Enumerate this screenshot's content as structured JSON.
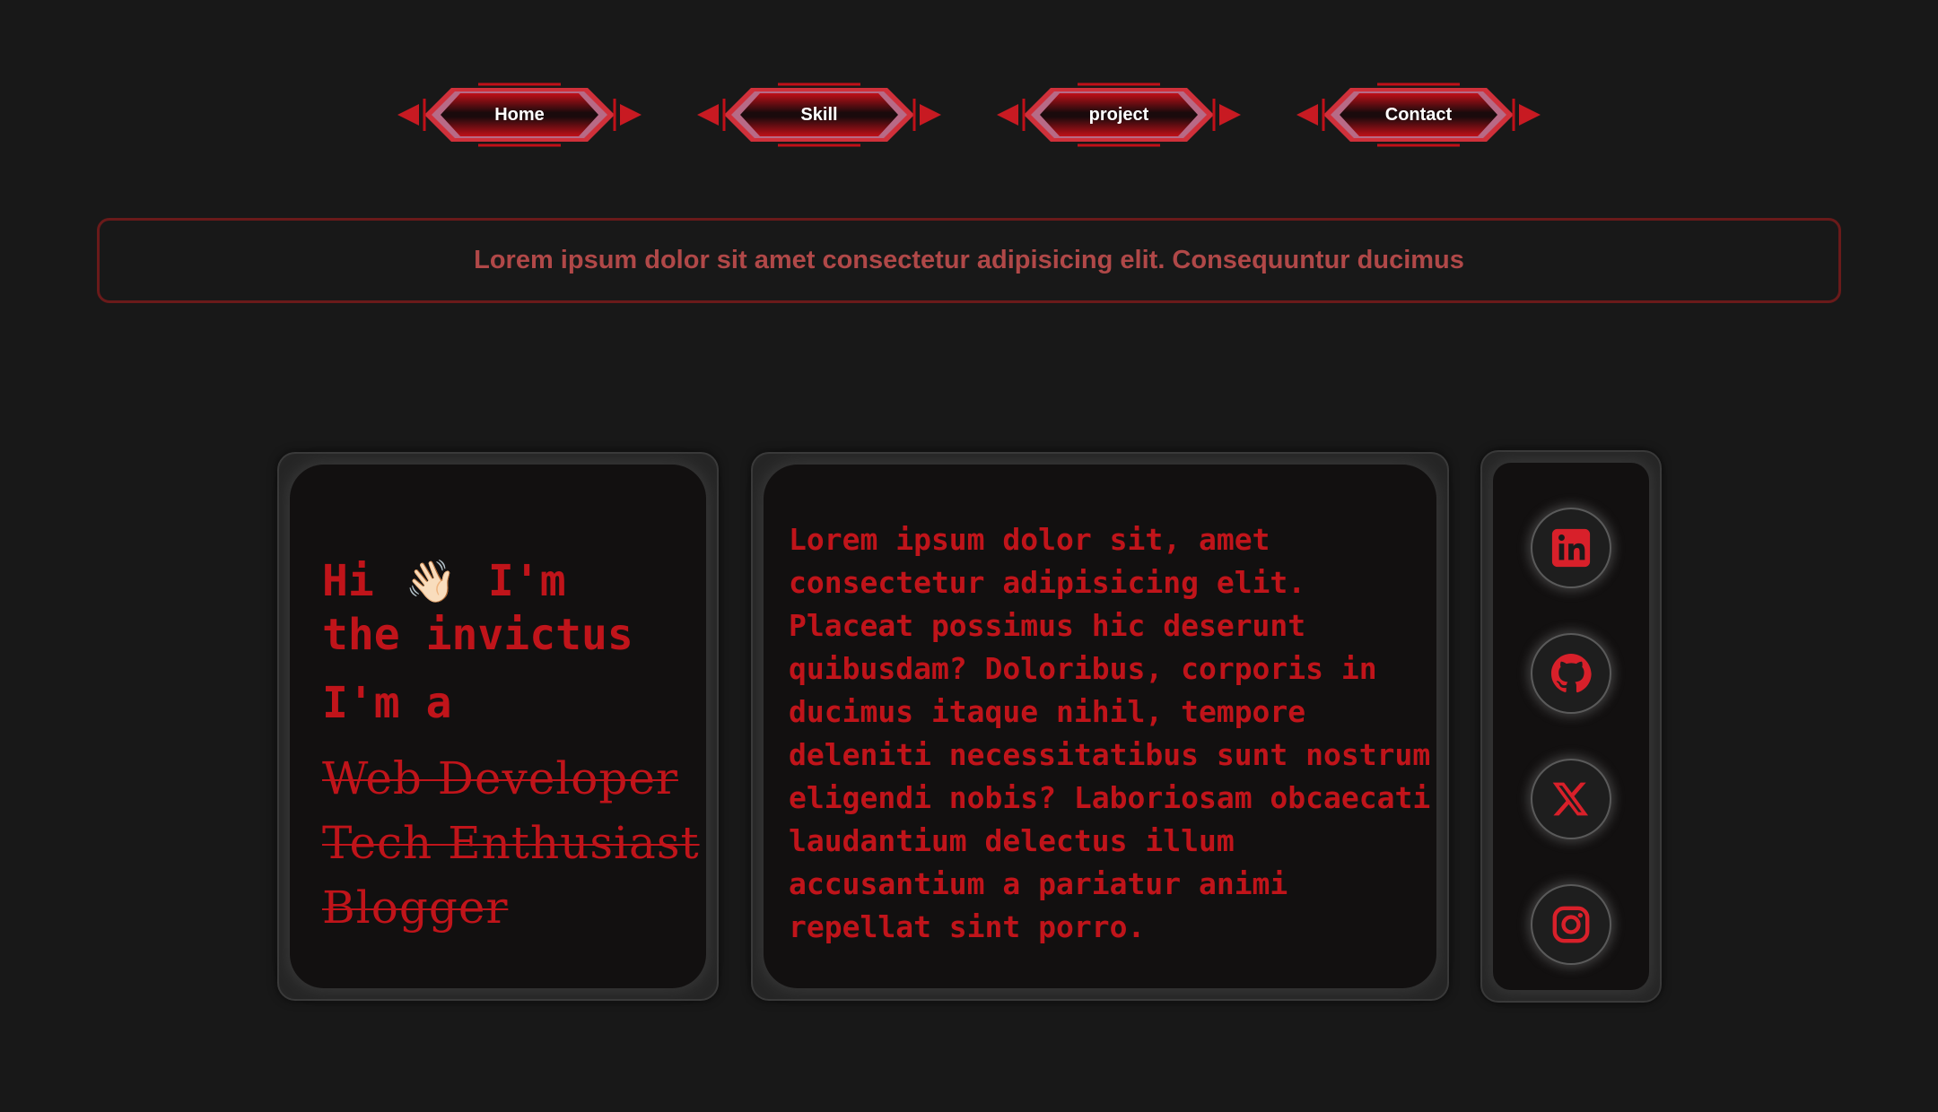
{
  "nav": {
    "items": [
      {
        "label": "Home"
      },
      {
        "label": "Skill"
      },
      {
        "label": "project"
      },
      {
        "label": "Contact"
      }
    ]
  },
  "banner": {
    "text": "Lorem ipsum dolor sit amet consectetur adipisicing elit. Consequuntur ducimus"
  },
  "intro": {
    "greeting_prefix": "Hi",
    "wave_emoji": "👋🏻",
    "greeting_suffix": "I'm",
    "name_line": "the invictus",
    "im_a": "I'm a",
    "roles": [
      "Web Developer",
      "Tech Enthusiast",
      "Blogger"
    ]
  },
  "about": {
    "text": "Lorem ipsum dolor sit, amet consectetur adipisicing elit. Placeat possimus hic deserunt quibusdam? Doloribus, corporis in ducimus itaque nihil, tempore deleniti necessitatibus sunt nostrum eligendi nobis? Laboriosam obcaecati laudantium delectus illum accusantium a pariatur animi repellat sint porro."
  },
  "social": {
    "icons": [
      "linkedin-icon",
      "github-icon",
      "x-icon",
      "instagram-icon"
    ]
  },
  "colors": {
    "background": "#181818",
    "accent_red": "#c0141a",
    "banner_text": "#b04848",
    "banner_border": "#6a1a1a"
  }
}
